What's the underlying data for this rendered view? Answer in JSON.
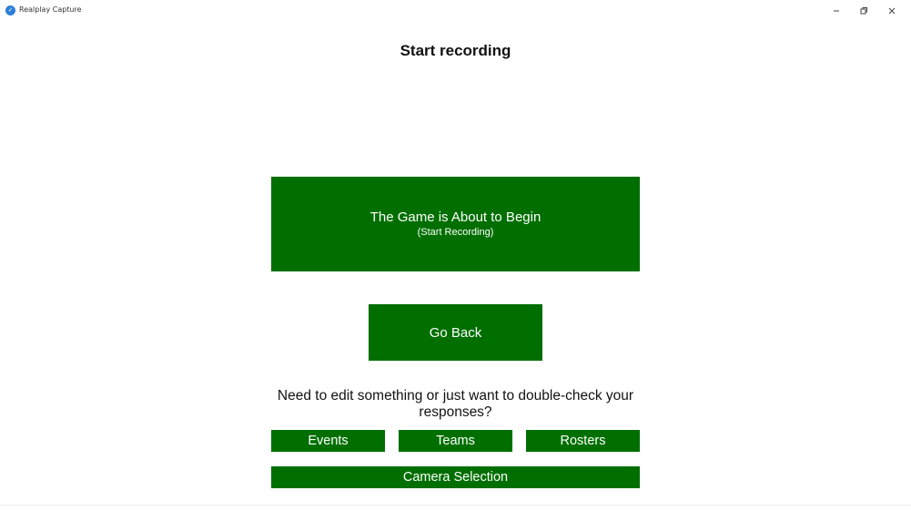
{
  "window": {
    "title": "Realplay Capture",
    "icon": "app-logo-icon",
    "controls": [
      "minimize-icon",
      "restore-icon",
      "close-icon"
    ]
  },
  "page": {
    "title": "Start recording"
  },
  "start_button": {
    "label": "The Game is About to Begin",
    "sublabel": "(Start Recording)"
  },
  "back_button": {
    "label": "Go Back"
  },
  "review": {
    "prompt": "Need to edit something or just want to double-check your responses?",
    "events_label": "Events",
    "teams_label": "Teams",
    "rosters_label": "Rosters",
    "camera_label": "Camera Selection"
  },
  "colors": {
    "button_green": "#006f00",
    "button_text": "#ffffff",
    "background": "#ffffff"
  }
}
